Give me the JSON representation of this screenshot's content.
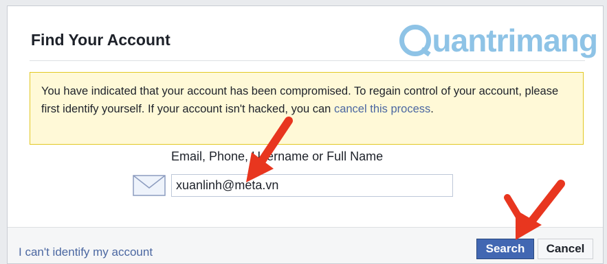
{
  "dialog": {
    "title": "Find Your Account"
  },
  "watermark": {
    "text": "uantrimang"
  },
  "notice": {
    "text": "You have indicated that your account has been compromised. To regain control of your account, please first identify yourself. If your account isn't hacked, you can ",
    "link": "cancel this process",
    "end": "."
  },
  "form": {
    "label": "Email, Phone, Username or Full Name",
    "email_value": "xuanlinh@meta.vn"
  },
  "footer": {
    "cant_identify_link": "I can't identify my account",
    "search_label": "Search",
    "cancel_label": "Cancel"
  },
  "colors": {
    "accent": "#4267b2",
    "link": "#4b67a1",
    "notice_bg": "#fff9d7",
    "notice_border": "#e2c822",
    "annotation_arrow": "#e8361f"
  },
  "icons": [
    "envelope-icon",
    "annotation-arrow-icon"
  ]
}
